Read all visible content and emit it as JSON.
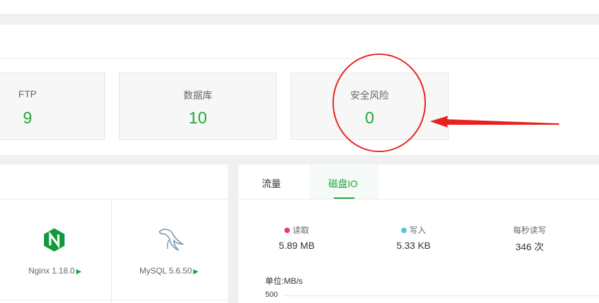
{
  "stats": [
    {
      "label": "FTP",
      "value": "9"
    },
    {
      "label": "数据库",
      "value": "10"
    },
    {
      "label": "安全风险",
      "value": "0"
    }
  ],
  "software": [
    {
      "name": "Nginx 1.18.0",
      "icon": "nginx-icon"
    },
    {
      "name": "MySQL 5.6.50",
      "icon": "mysql-dolphin-icon"
    }
  ],
  "tabs": {
    "traffic": "流量",
    "disk_io": "磁盘IO",
    "active": "disk_io"
  },
  "disk_io": {
    "read": {
      "label": "读取",
      "value": "5.89 MB",
      "color": "#e83e6c"
    },
    "write": {
      "label": "写入",
      "value": "5.33 KB",
      "color": "#5bc0de"
    },
    "iops": {
      "label": "每秒读写",
      "value": "346 次"
    }
  },
  "chart": {
    "unit_label": "单位:MB/s",
    "y_tick": "500"
  },
  "colors": {
    "accent": "#20a53a",
    "annotation": "#e8201e"
  }
}
